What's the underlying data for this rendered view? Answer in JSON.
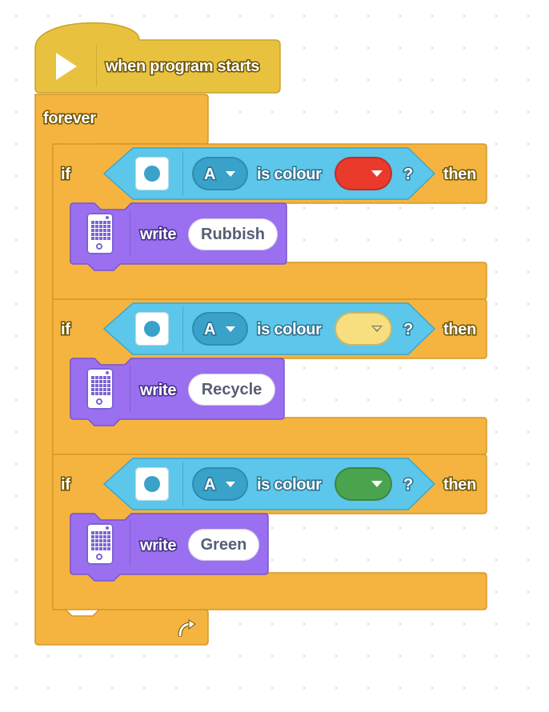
{
  "hat": {
    "label": "when program starts",
    "icon": "play-flag-icon"
  },
  "loop": {
    "label": "forever",
    "end_icon": "loop-arrow-icon"
  },
  "conditions": [
    {
      "if_label": "if",
      "port": "A",
      "sensor_text": "is colour",
      "colour_name": "red",
      "colour_hex": "#e93a2c",
      "question": "?",
      "then_label": "then",
      "write_label": "write",
      "write_value": "Rubbish"
    },
    {
      "if_label": "if",
      "port": "A",
      "sensor_text": "is colour",
      "colour_name": "yellow",
      "colour_hex": "#f7df80",
      "question": "?",
      "then_label": "then",
      "write_label": "write",
      "write_value": "Recycle"
    },
    {
      "if_label": "if",
      "port": "A",
      "sensor_text": "is colour",
      "colour_name": "green",
      "colour_hex": "#4aa44e",
      "question": "?",
      "then_label": "then",
      "write_label": "write",
      "write_value": "Green"
    }
  ],
  "colors": {
    "event_block": "#e8c23e",
    "control_block": "#f4b43f",
    "sensor_block": "#5cc7ea",
    "display_block": "#9a6ff0"
  }
}
